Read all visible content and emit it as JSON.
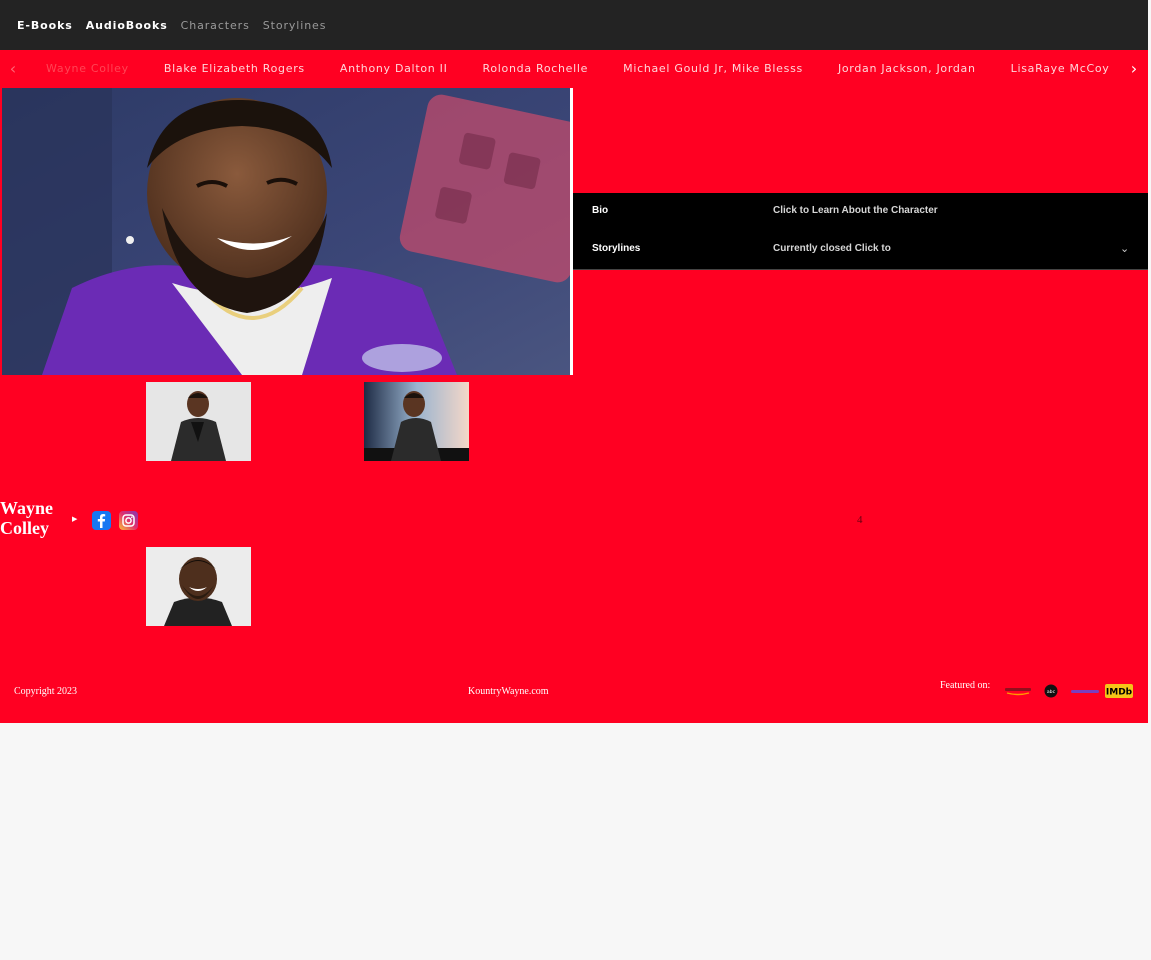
{
  "nav": {
    "items": [
      {
        "label": "E-Books",
        "active": true
      },
      {
        "label": "AudioBooks",
        "active": true
      },
      {
        "label": "Characters",
        "active": false
      },
      {
        "label": "Storylines",
        "active": false
      }
    ]
  },
  "carousel": {
    "names": [
      "Wayne Colley",
      "Blake Elizabeth Rogers",
      "Anthony Dalton II",
      "Rolonda Rochelle",
      "Michael Gould Jr, Mike Blesss",
      "Jordan Jackson, Jordan",
      "LisaRaye McCoy"
    ]
  },
  "info": {
    "bio_label": "Bio",
    "bio_value": "Click to Learn About the Character",
    "storylines_label": "Storylines",
    "storylines_value": "Currently closed Click to"
  },
  "profile": {
    "name_line1": "Wayne",
    "name_line2": "Colley",
    "pager_value": "4"
  },
  "footer": {
    "copyright": "Copyright 2023",
    "site": "KountryWayne.com",
    "featured_label": "Featured on:",
    "logos": [
      "amazon-logo",
      "abc-logo",
      "hulu-logo",
      "imdb-logo"
    ],
    "imdb_text": "IMDb"
  },
  "colors": {
    "brand_red": "#ff0022",
    "topbar": "#232323"
  }
}
